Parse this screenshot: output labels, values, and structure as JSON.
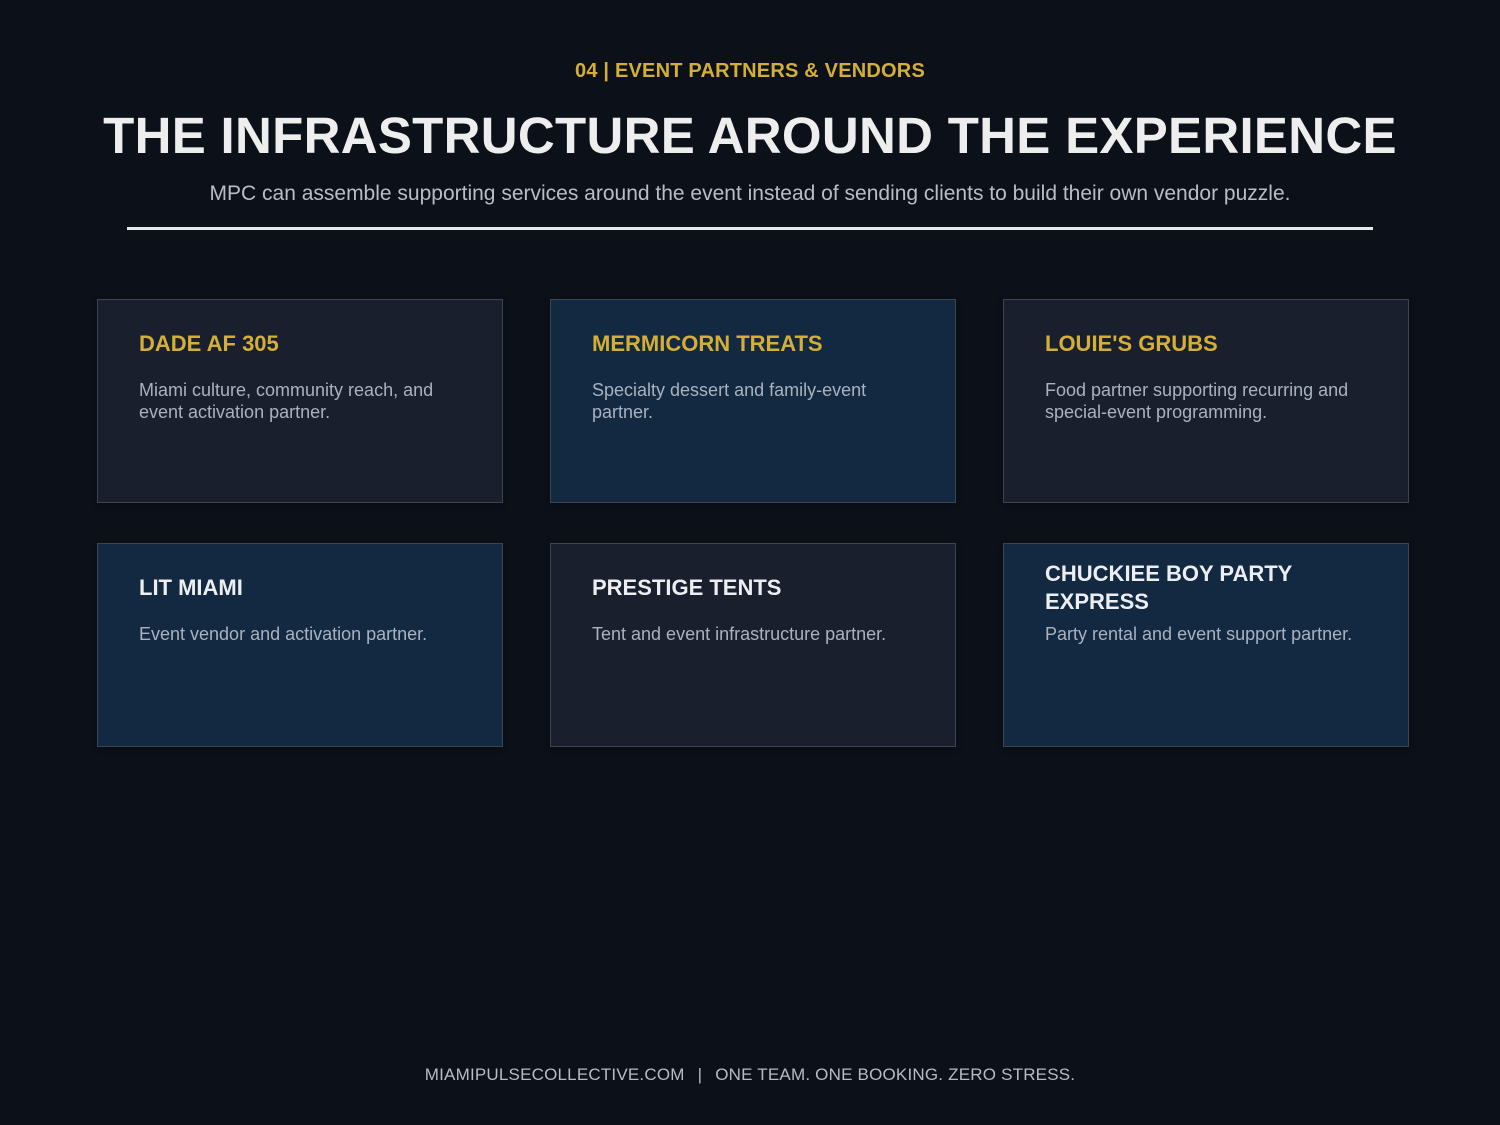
{
  "header": {
    "eyebrow": "04 | EVENT PARTNERS & VENDORS",
    "title": "THE INFRASTRUCTURE AROUND THE EXPERIENCE",
    "subtitle": "MPC can assemble supporting services around the event instead of sending clients to build their own vendor puzzle."
  },
  "partners": [
    {
      "name": "DADE AF 305",
      "description": "Miami culture, community reach, and event activation partner."
    },
    {
      "name": "MERMICORN TREATS",
      "description": "Specialty dessert and family-event partner."
    },
    {
      "name": "LOUIE'S GRUBS",
      "description": "Food partner supporting recurring and special-event programming."
    },
    {
      "name": "LIT MIAMI",
      "description": "Event vendor and activation partner."
    },
    {
      "name": "PRESTIGE TENTS",
      "description": "Tent and event infrastructure partner."
    },
    {
      "name": "CHUCKIEE BOY PARTY EXPRESS",
      "description": "Party rental and event support partner."
    }
  ],
  "footer": {
    "website": "MIAMIPULSECOLLECTIVE.COM",
    "separator": "|",
    "tagline": "ONE TEAM. ONE BOOKING. ZERO STRESS."
  },
  "colors": {
    "background": "#0c1119",
    "accent_gold": "#d4af37",
    "card_dark": "#1a1f2d",
    "card_navy": "#132841"
  }
}
